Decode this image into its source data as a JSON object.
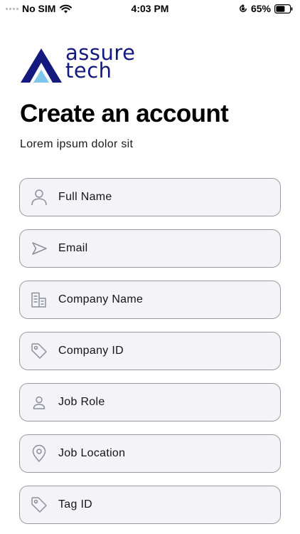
{
  "status_bar": {
    "carrier": "No SIM",
    "time": "4:03 PM",
    "battery": "65%",
    "battery_level": 0.65
  },
  "logo": {
    "line1": "assure",
    "line2": "tech",
    "brand_color": "#141a7d",
    "accent_color": "#7cc7ea"
  },
  "header": {
    "title": "Create an account",
    "subtitle": "Lorem ipsum dolor sit"
  },
  "form": {
    "fields": [
      {
        "label": "Full Name",
        "icon": "user-icon"
      },
      {
        "label": "Email",
        "icon": "send-icon"
      },
      {
        "label": "Company Name",
        "icon": "building-icon"
      },
      {
        "label": "Company ID",
        "icon": "tag-icon"
      },
      {
        "label": "Job Role",
        "icon": "user-icon"
      },
      {
        "label": "Job Location",
        "icon": "location-pin-icon"
      },
      {
        "label": "Tag ID",
        "icon": "tag-icon"
      }
    ]
  }
}
